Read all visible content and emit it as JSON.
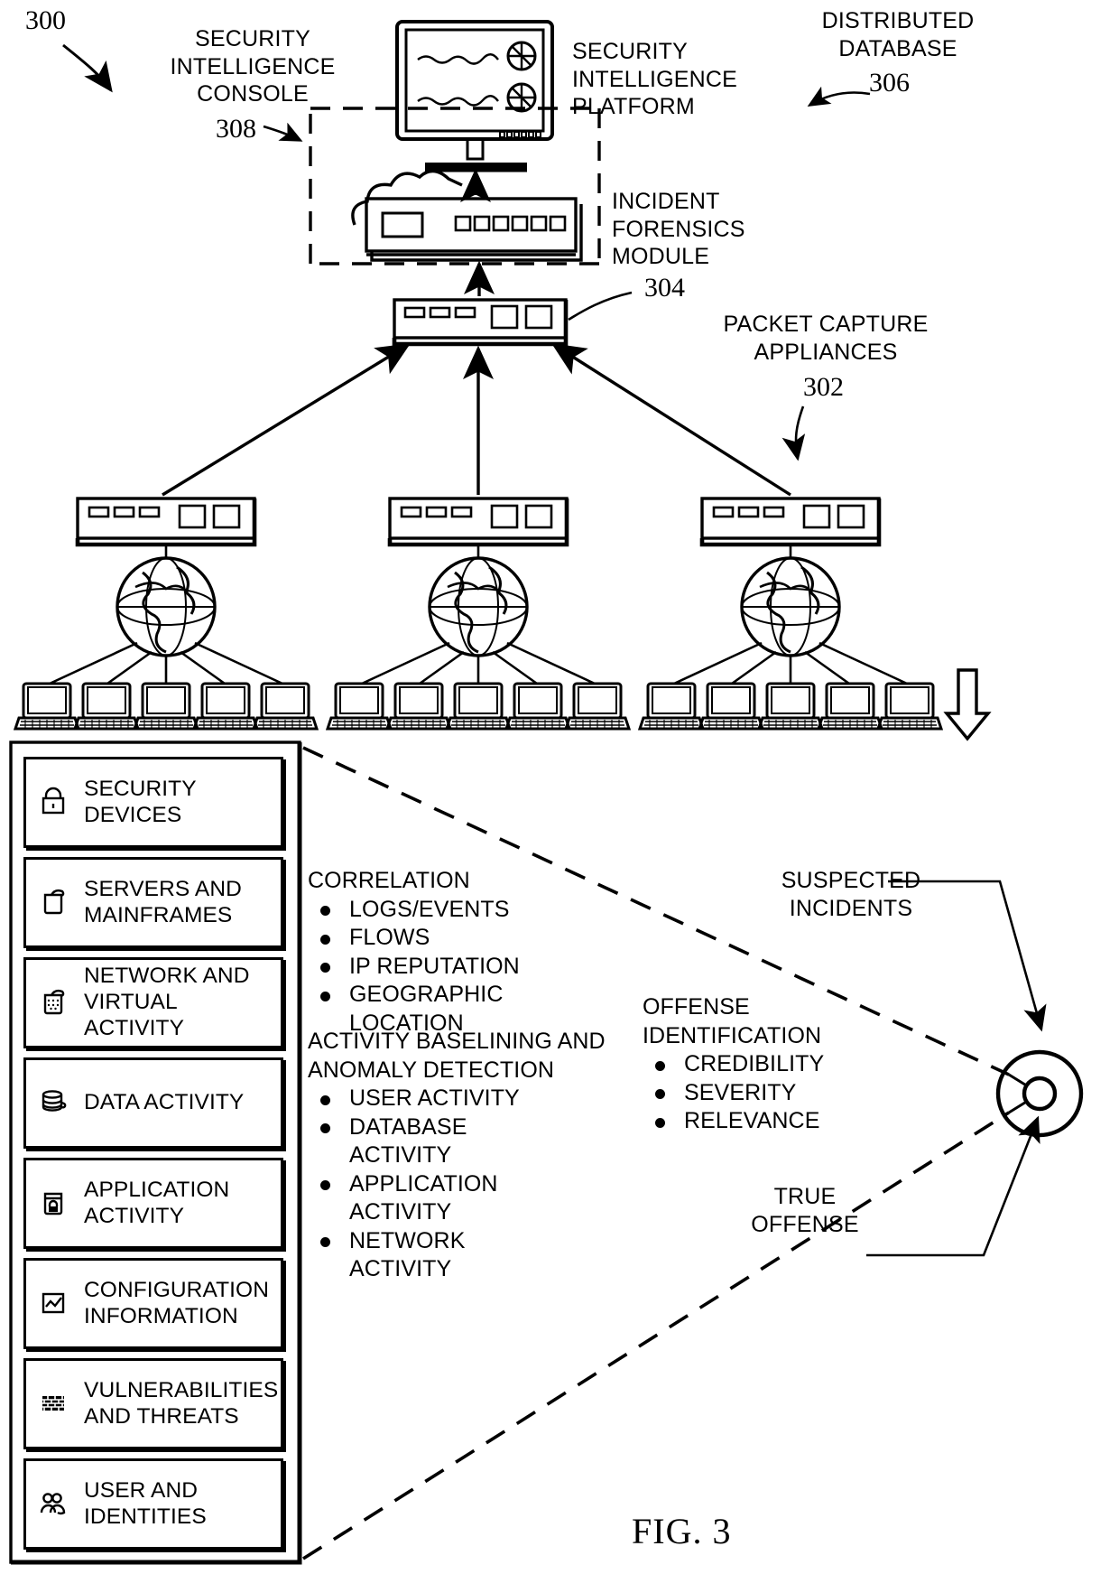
{
  "figure": {
    "id": "300",
    "caption": "FIG. 3"
  },
  "callouts": {
    "security_intelligence_console": {
      "label": "SECURITY\nINTELLIGENCE\nCONSOLE",
      "ref": "308"
    },
    "security_intelligence_platform": {
      "label": "SECURITY\nINTELLIGENCE\nPLATFORM"
    },
    "distributed_database": {
      "label": "DISTRIBUTED\nDATABASE",
      "ref": "306"
    },
    "incident_forensics_module": {
      "label": "INCIDENT\nFORENSICS\nMODULE",
      "ref": "304"
    },
    "packet_capture_appliances": {
      "label": "PACKET CAPTURE\nAPPLIANCES",
      "ref": "302"
    },
    "suspected_incidents": {
      "label": "SUSPECTED\nINCIDENTS"
    },
    "true_offense": {
      "label": "TRUE\nOFFENSE"
    }
  },
  "sources": {
    "items": [
      {
        "label": "SECURITY\nDEVICES",
        "icon": "padlock-icon"
      },
      {
        "label": "SERVERS AND\nMAINFRAMES",
        "icon": "server-bucket-icon"
      },
      {
        "label": "NETWORK AND\nVIRTUAL ACTIVITY",
        "icon": "network-bucket-icon"
      },
      {
        "label": "DATA ACTIVITY",
        "icon": "database-cylinder-icon"
      },
      {
        "label": "APPLICATION\nACTIVITY",
        "icon": "application-lock-icon"
      },
      {
        "label": "CONFIGURATION\nINFORMATION",
        "icon": "chart-window-icon"
      },
      {
        "label": "VULNERABILITIES\nAND THREATS",
        "icon": "brick-wall-icon"
      },
      {
        "label": "USER AND\nIDENTITIES",
        "icon": "users-group-icon"
      }
    ]
  },
  "analytics": {
    "correlation": {
      "heading": "CORRELATION",
      "bullets": [
        "LOGS/EVENTS",
        "FLOWS",
        "IP REPUTATION",
        "GEOGRAPHIC LOCATION"
      ]
    },
    "baselining": {
      "heading": "ACTIVITY BASELINING AND\nANOMALY DETECTION",
      "bullets": [
        "USER ACTIVITY",
        "DATABASE\nACTIVITY",
        "APPLICATION\nACTIVITY",
        "NETWORK\nACTIVITY"
      ]
    },
    "offense": {
      "heading": "OFFENSE\nIDENTIFICATION",
      "bullets": [
        "CREDIBILITY",
        "SEVERITY",
        "RELEVANCE"
      ]
    }
  },
  "colors": {
    "ink": "#000000",
    "paper": "#ffffff"
  }
}
